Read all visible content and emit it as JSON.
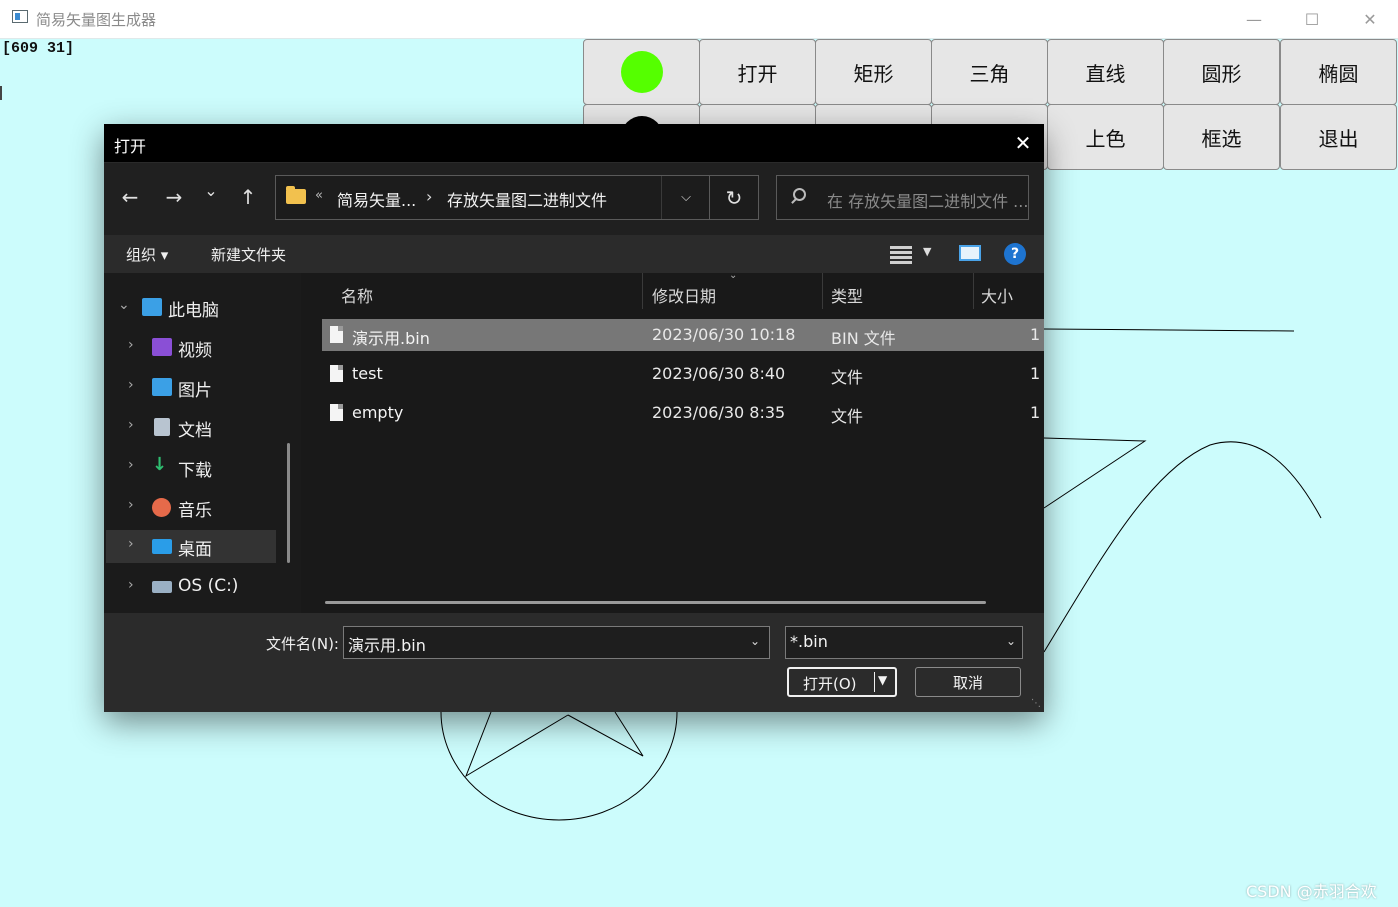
{
  "window": {
    "title": "简易矢量图生成器",
    "minimize": "—",
    "maximize": "☐",
    "close": "✕",
    "coord_readout": "[609 31]"
  },
  "toolbar": {
    "row1": [
      "",
      "打开",
      "矩形",
      "三角",
      "直线",
      "圆形",
      "椭圆"
    ],
    "row2": [
      "",
      "",
      "",
      "",
      "上色",
      "框选",
      "退出"
    ],
    "fill_color": "#55ff00",
    "stroke_color": "#000000"
  },
  "dialog": {
    "title": "打开",
    "close": "✕",
    "nav": {
      "back": "←",
      "forward": "→",
      "recent": "⌄",
      "up": "↑"
    },
    "breadcrumb": {
      "more": "«",
      "parent": "简易矢量...",
      "separator": "›",
      "current": "存放矢量图二进制文件"
    },
    "refresh": "↻",
    "search_placeholder": "在 存放矢量图二进制文件 ...",
    "commands": {
      "organize": "组织 ▾",
      "new_folder": "新建文件夹",
      "help": "?"
    },
    "sidebar": [
      {
        "label": "此电脑",
        "expanded": true,
        "icon": "computer-icon",
        "color": "#3ba0e6"
      },
      {
        "label": "视频",
        "icon": "video-icon",
        "color": "#8a4fd6"
      },
      {
        "label": "图片",
        "icon": "pictures-icon",
        "color": "#3ba0e6"
      },
      {
        "label": "文档",
        "icon": "documents-icon",
        "color": "#b8c4d0"
      },
      {
        "label": "下载",
        "icon": "download-icon",
        "color": "#2fbf71"
      },
      {
        "label": "音乐",
        "icon": "music-icon",
        "color": "#e66a4a"
      },
      {
        "label": "桌面",
        "icon": "desktop-icon",
        "color": "#2a9de8",
        "selected": true
      },
      {
        "label": "OS (C:)",
        "icon": "drive-icon",
        "color": "#9ab0c4"
      }
    ],
    "columns": [
      "名称",
      "修改日期",
      "类型",
      "大小"
    ],
    "files": [
      {
        "name": "演示用.bin",
        "date": "2023/06/30 10:18",
        "type": "BIN 文件",
        "size": "1",
        "selected": true
      },
      {
        "name": "test",
        "date": "2023/06/30 8:40",
        "type": "文件",
        "size": "1"
      },
      {
        "name": "empty",
        "date": "2023/06/30 8:35",
        "type": "文件",
        "size": "1"
      }
    ],
    "filename_label": "文件名(N):",
    "filename_value": "演示用.bin",
    "filter_value": "*.bin",
    "open_button": "打开(O)",
    "cancel_button": "取消"
  },
  "watermark": "CSDN @赤羽合欢"
}
